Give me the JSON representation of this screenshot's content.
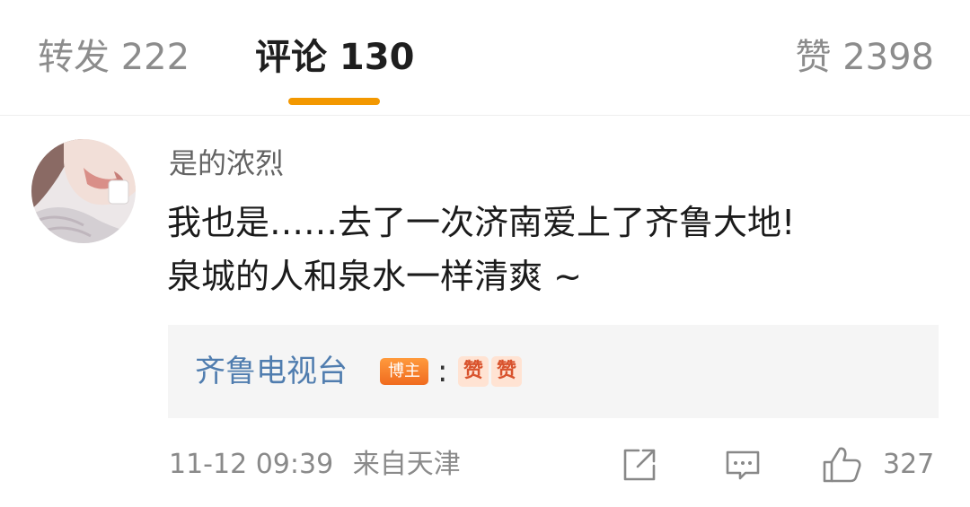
{
  "tabs": {
    "repost": "转发 222",
    "comments": "评论 130",
    "likes": "赞 2398",
    "active_color": "#f39800"
  },
  "comment": {
    "username": "是的浓烈",
    "text_line1": "我也是……去了一次济南爱上了齐鲁大地!",
    "text_line2": "泉城的人和泉水一样清爽 ~"
  },
  "reply": {
    "author": "齐鲁电视台",
    "badge": "博主",
    "separator": ":",
    "emoji": [
      "赞",
      "赞"
    ],
    "author_color": "#507daf"
  },
  "meta": {
    "timestamp": "11-12 09:39",
    "source": "来自天津",
    "like_count": "327"
  },
  "icons": {
    "share": "share-icon",
    "comment": "comment-icon",
    "like": "thumbs-up-icon"
  }
}
